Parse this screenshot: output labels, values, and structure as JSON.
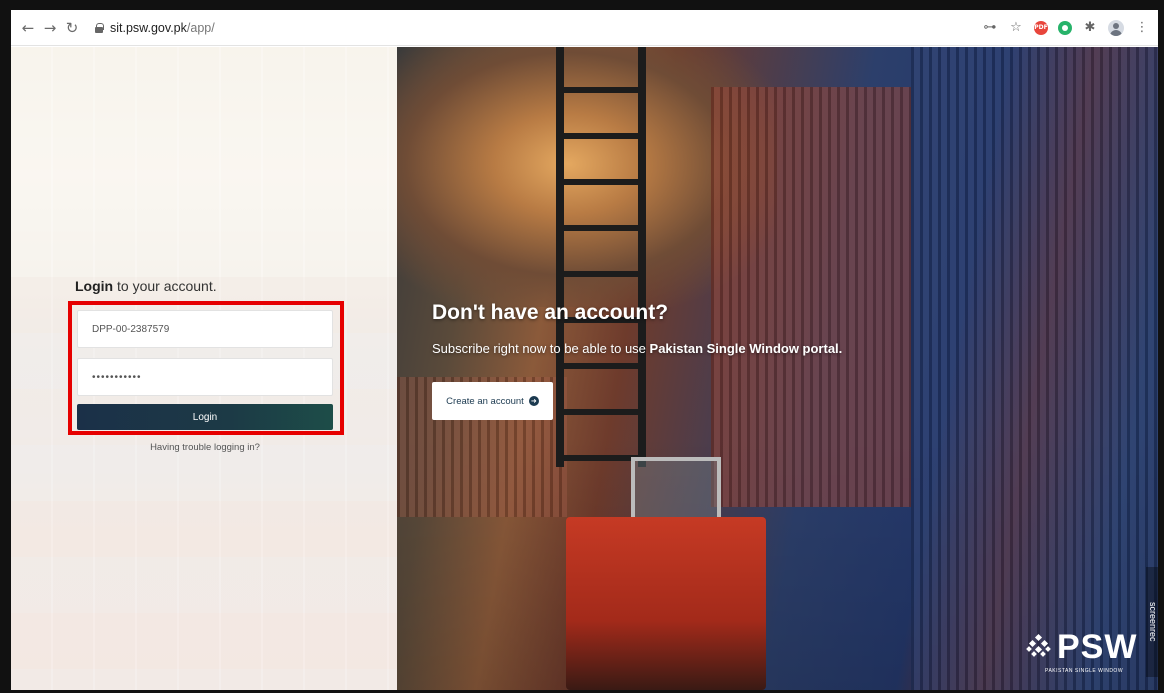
{
  "browser": {
    "url_host": "sit.psw.gov.pk",
    "url_path": "/app/",
    "ext_badge": "PDF"
  },
  "login": {
    "title_bold": "Login",
    "title_rest": " to your account.",
    "username_value": "DPP-00-2387579",
    "password_value": "•••••••••••",
    "login_label": "Login",
    "trouble_link": "Having trouble logging in?"
  },
  "cta": {
    "heading": "Don't have an account?",
    "sub_text": "Subscribe right now to be able to use ",
    "sub_bold": "Pakistan Single Window portal.",
    "create_label": "Create an account"
  },
  "logo": {
    "name": "PSW",
    "subtitle": "PAKISTAN SINGLE WINDOW"
  },
  "watermark": "screenrec",
  "colors": {
    "highlight_border": "#e60000",
    "login_button": "#1c3a46"
  }
}
